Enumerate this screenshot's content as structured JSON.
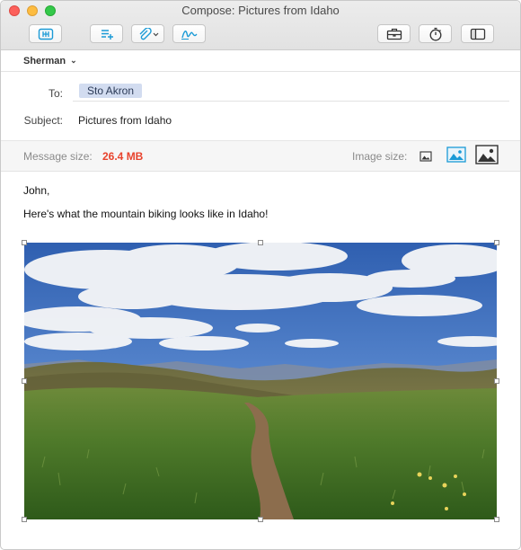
{
  "window": {
    "title": "Compose: Pictures from Idaho"
  },
  "toolbar": {
    "buttons": [
      {
        "icon": "send-icon"
      },
      {
        "icon": "format-list-icon"
      },
      {
        "icon": "attachment-icon"
      },
      {
        "icon": "signature-icon"
      },
      {
        "icon": "briefcase-icon"
      },
      {
        "icon": "timer-icon"
      },
      {
        "icon": "sidebar-icon"
      }
    ]
  },
  "from": {
    "account": "Sherman"
  },
  "headers": {
    "to_label": "To:",
    "to_recipient": "Sto Akron",
    "subject_label": "Subject:",
    "subject_value": "Pictures from Idaho"
  },
  "size_bar": {
    "message_size_label": "Message size:",
    "message_size_value": "26.4 MB",
    "image_size_label": "Image size:",
    "image_size_options": [
      "small",
      "medium",
      "large"
    ],
    "selected_option": "medium"
  },
  "message": {
    "greeting": "John,",
    "body": "Here's what the mountain biking looks like in Idaho!"
  },
  "colors": {
    "accent": "#1a9ad6",
    "size_warning": "#e8432d",
    "recipient_chip": "#d2dcf0"
  }
}
